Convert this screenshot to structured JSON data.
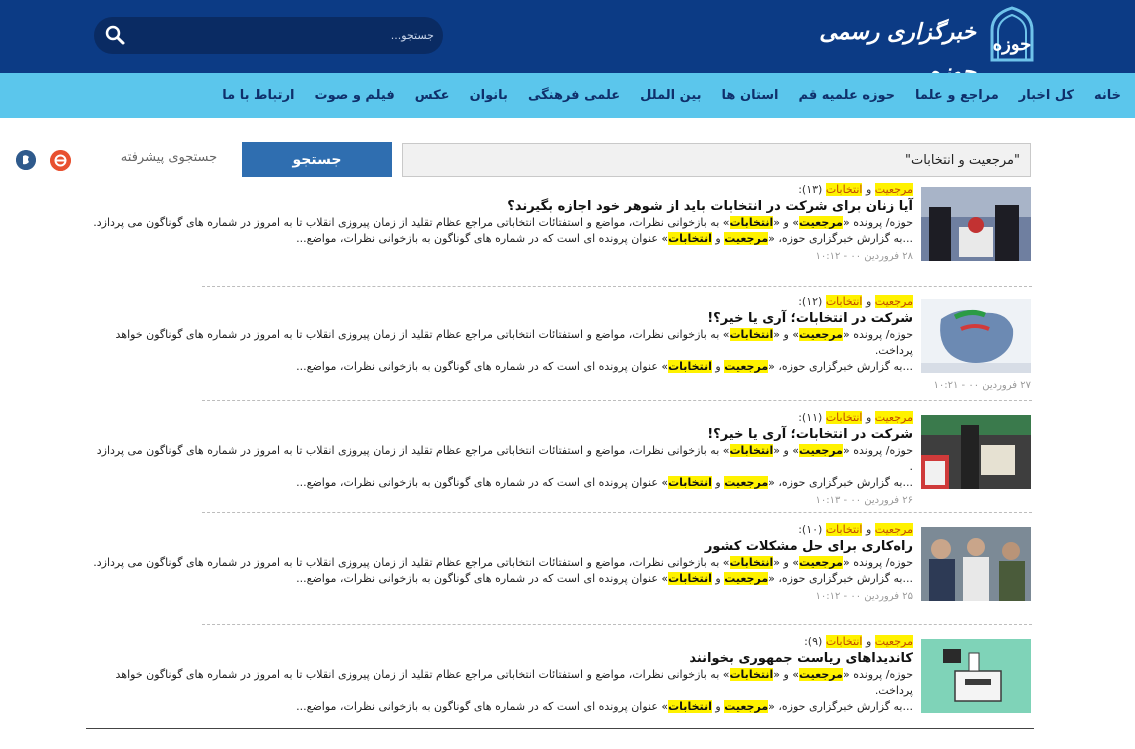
{
  "header": {
    "logo_text": "خبرگزاری رسمی حوزه",
    "search_placeholder": "جستجو...",
    "colors": {
      "top": "#0c3b85",
      "nav": "#5bc6ec"
    }
  },
  "nav": [
    "خانه",
    "کل اخبار",
    "مراجع و علما",
    "حوزه علمیه قم",
    "استان ها",
    "بین الملل",
    "علمی فرهنگی",
    "بانوان",
    "عکس",
    "فیلم و صوت",
    "ارتباط با ما"
  ],
  "search": {
    "query": "\"مرجعیت و انتخابات\"",
    "button": "جستجو",
    "advanced": "جستجوی پیشرفته"
  },
  "results": [
    {
      "cat_a": "مرجعیت",
      "cat_mid": " و ",
      "cat_b": "انتخابات",
      "cat_num": " (۱۳):",
      "title": "آیا زنان برای شرکت در انتخابات باید از شوهر خود اجازه بگیرند؟",
      "s1_pre": "حوزه/ پرونده «",
      "s1_k1": "مرجعیت",
      "s1_mid": "» و «",
      "s1_k2": "انتخابات",
      "s1_post": "» به بازخوانی نظرات، مواضع و استفتائات انتخاباتی مراجع عظام تقلید از زمان پیروزی انقلاب تا به امروز در شماره های گوناگون می پردازد.",
      "s2_pre": "...به گزارش خبرگزاری حوزه، «",
      "s2_k1": "مرجعیت",
      "s2_mid": " و ",
      "s2_k2": "انتخابات",
      "s2_post": "» عنوان پرونده ای است که در شماره های گوناگون به بازخوانی نظرات، مواضع...",
      "date": "۲۸ فروردین ۰۰ - ۱۰:۱۲"
    },
    {
      "cat_a": "مرجعیت",
      "cat_mid": " و ",
      "cat_b": "انتخابات",
      "cat_num": " (۱۲):",
      "title": "شرکت در انتخابات؛ آری یا خیر؟!",
      "s1_pre": "حوزه/ پرونده «",
      "s1_k1": "مرجعیت",
      "s1_mid": "» و «",
      "s1_k2": "انتخابات",
      "s1_post": "» به بازخوانی نظرات، مواضع و استفتائات انتخاباتی مراجع عظام تقلید از زمان پیروزی انقلاب تا به امروز در شماره های گوناگون خواهد پرداخت.",
      "s2_pre": "...به گزارش خبرگزاری حوزه، «",
      "s2_k1": "مرجعیت",
      "s2_mid": " و ",
      "s2_k2": "انتخابات",
      "s2_post": "» عنوان پرونده ای است که در شماره های گوناگون به بازخوانی نظرات، مواضع...",
      "date": "۲۷ فروردین ۰۰ - ۱۰:۲۱"
    },
    {
      "cat_a": "مرجعیت",
      "cat_mid": " و ",
      "cat_b": "انتخابات",
      "cat_num": " (۱۱):",
      "title": "شرکت در انتخابات؛ آری یا خیر؟!",
      "s1_pre": "حوزه/ پرونده «",
      "s1_k1": "مرجعیت",
      "s1_mid": "» و «",
      "s1_k2": "انتخابات",
      "s1_post": "» به بازخوانی نظرات، مواضع و استفتائات انتخاباتی مراجع عظام تقلید از زمان پیروزی انقلاب تا به امروز در شماره های گوناگون می پردازد .",
      "s2_pre": "...به گزارش خبرگزاری حوزه، «",
      "s2_k1": "مرجعیت",
      "s2_mid": " و ",
      "s2_k2": "انتخابات",
      "s2_post": "» عنوان پرونده ای است که در شماره های گوناگون به بازخوانی نظرات، مواضع...",
      "date": "۲۶ فروردین ۰۰ - ۱۰:۱۳"
    },
    {
      "cat_a": "مرجعیت",
      "cat_mid": " و ",
      "cat_b": "انتخابات",
      "cat_num": " (۱۰):",
      "title": "راه‌کاری برای حل مشکلات کشور",
      "s1_pre": "حوزه/ پرونده «",
      "s1_k1": "مرجعیت",
      "s1_mid": "» و «",
      "s1_k2": "انتخابات",
      "s1_post": "» به بازخوانی نظرات، مواضع و استفتائات انتخاباتی مراجع عظام تقلید از زمان پیروزی انقلاب تا به امروز در شماره های گوناگون می پردازد.",
      "s2_pre": "...به گزارش خبرگزاری حوزه، «",
      "s2_k1": "مرجعیت",
      "s2_mid": " و ",
      "s2_k2": "انتخابات",
      "s2_post": "» عنوان پرونده ای است که در شماره های گوناگون به بازخوانی نظرات، مواضع...",
      "date": "۲۵ فروردین ۰۰ - ۱۰:۱۲"
    },
    {
      "cat_a": "مرجعیت",
      "cat_mid": " و ",
      "cat_b": "انتخابات",
      "cat_num": " (۹):",
      "title": "کاندیداهای ریاست جمهوری بخوانند",
      "s1_pre": "حوزه/ پرونده «",
      "s1_k1": "مرجعیت",
      "s1_mid": "» و «",
      "s1_k2": "انتخابات",
      "s1_post": "» به بازخوانی نظرات، مواضع و استفتائات انتخاباتی مراجع عظام تقلید از زمان پیروزی انقلاب تا به امروز در شماره های گوناگون خواهد پرداخت.",
      "s2_pre": "...به گزارش خبرگزاری حوزه، «",
      "s2_k1": "مرجعیت",
      "s2_mid": " و ",
      "s2_k2": "انتخابات",
      "s2_post": "» عنوان پرونده ای است که در شماره های گوناگون به بازخوانی نظرات، مواضع...",
      "date": ""
    }
  ]
}
